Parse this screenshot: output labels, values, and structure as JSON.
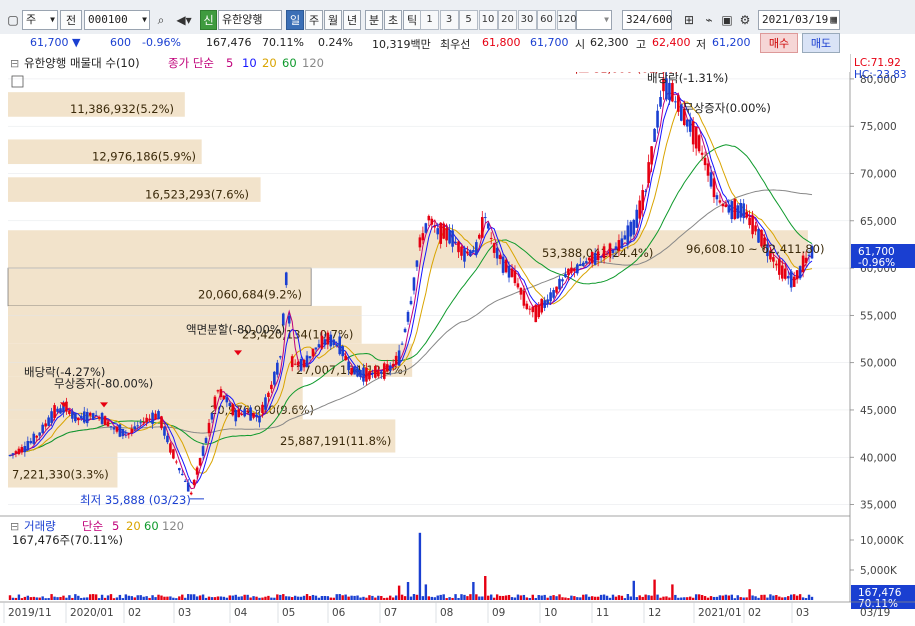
{
  "toolbar": {
    "type_select": "주",
    "prev_label": "전",
    "code": "000100",
    "badge": "신",
    "stock_name": "유한양행",
    "periods": [
      "일",
      "주",
      "월",
      "년",
      "분",
      "초",
      "틱"
    ],
    "active_period": "일",
    "intervals": [
      "1",
      "3",
      "5",
      "10",
      "20",
      "30",
      "60",
      "120"
    ],
    "count": "324",
    "count_total": "/600",
    "date": "2021/03/19",
    "icons": [
      "layout-icon",
      "chart-type-icon",
      "save-icon",
      "settings-icon",
      "calendar-icon",
      "search-icon",
      "speaker-icon"
    ]
  },
  "quote": {
    "price": "61,700",
    "change": "600",
    "change_pct": "-0.96%",
    "volume": "167,476",
    "volume_ratio": "70.11%",
    "turnover_pct": "0.24%",
    "amount": "10,319백만",
    "best_label": "최우선",
    "best_ask": "61,800",
    "best_bid": "61,700",
    "open_label": "시",
    "open": "62,300",
    "high_label": "고",
    "high": "62,400",
    "low_label": "저",
    "low": "61,200",
    "buy_label": "매수",
    "sell_label": "매도"
  },
  "chart": {
    "legend_name": "유한양행 매물대 수(10)",
    "legend_ma_label": "종가 단순",
    "legend_ma_periods": [
      "5",
      "10",
      "20",
      "60",
      "120"
    ],
    "lc": "LC:71.92",
    "hc": "HC:-23.83",
    "price_ticks": [
      "80,000",
      "75,000",
      "70,000",
      "65,000",
      "60,000",
      "55,000",
      "50,000",
      "45,000",
      "40,000",
      "35,000"
    ],
    "current_price": "61,700",
    "current_pct": "-0.96%",
    "volume_profile": [
      "11,386,932(5.2%)",
      "12,976,186(5.9%)",
      "16,523,293(7.6%)",
      "53,388,041(24.4%)",
      "20,060,684(9.2%)",
      "23,420,134(10.7%)",
      "27,007,104(12.3%)",
      "20,976,910(9.6%)",
      "25,887,191(11.8%)",
      "7,221,330(3.3%)"
    ],
    "annotations": {
      "high": "최고 81,000 (01/06)",
      "low": "최저 35,888 (03/23)",
      "dividend1": "배당락(-4.27%)",
      "bonus_issue": "무상증자(-80.00%)",
      "split": "액면분할(-80.00%)",
      "dividend2": "배당락(-1.31%)",
      "rights": "무상증자(0.00%)",
      "range": "96,608.10 ~ 62,411.80)"
    },
    "vol_legend_name": "거래량",
    "vol_legend_ma_label": "단순",
    "vol_legend_ma_periods": [
      "5",
      "20",
      "60",
      "120"
    ],
    "vol_info": "167,476주(70.11%)",
    "vol_ticks": [
      "10,000K",
      "5,000K"
    ],
    "vol_current": "167,476",
    "vol_pct": "70.11%",
    "x_labels": [
      "2019/11",
      "2020/01",
      "02",
      "03",
      "04",
      "05",
      "06",
      "07",
      "08",
      "09",
      "10",
      "11",
      "12",
      "2021/01",
      "02",
      "03"
    ],
    "x_right": "03/19"
  },
  "colors": {
    "ma5": "#c0007a",
    "ma10": "#1515ff",
    "ma20": "#d9a400",
    "ma60": "#0f9a2c",
    "ma120": "#888888",
    "up": "#e60012",
    "down": "#1a3fd1",
    "profile": "#f2e3cb"
  }
}
